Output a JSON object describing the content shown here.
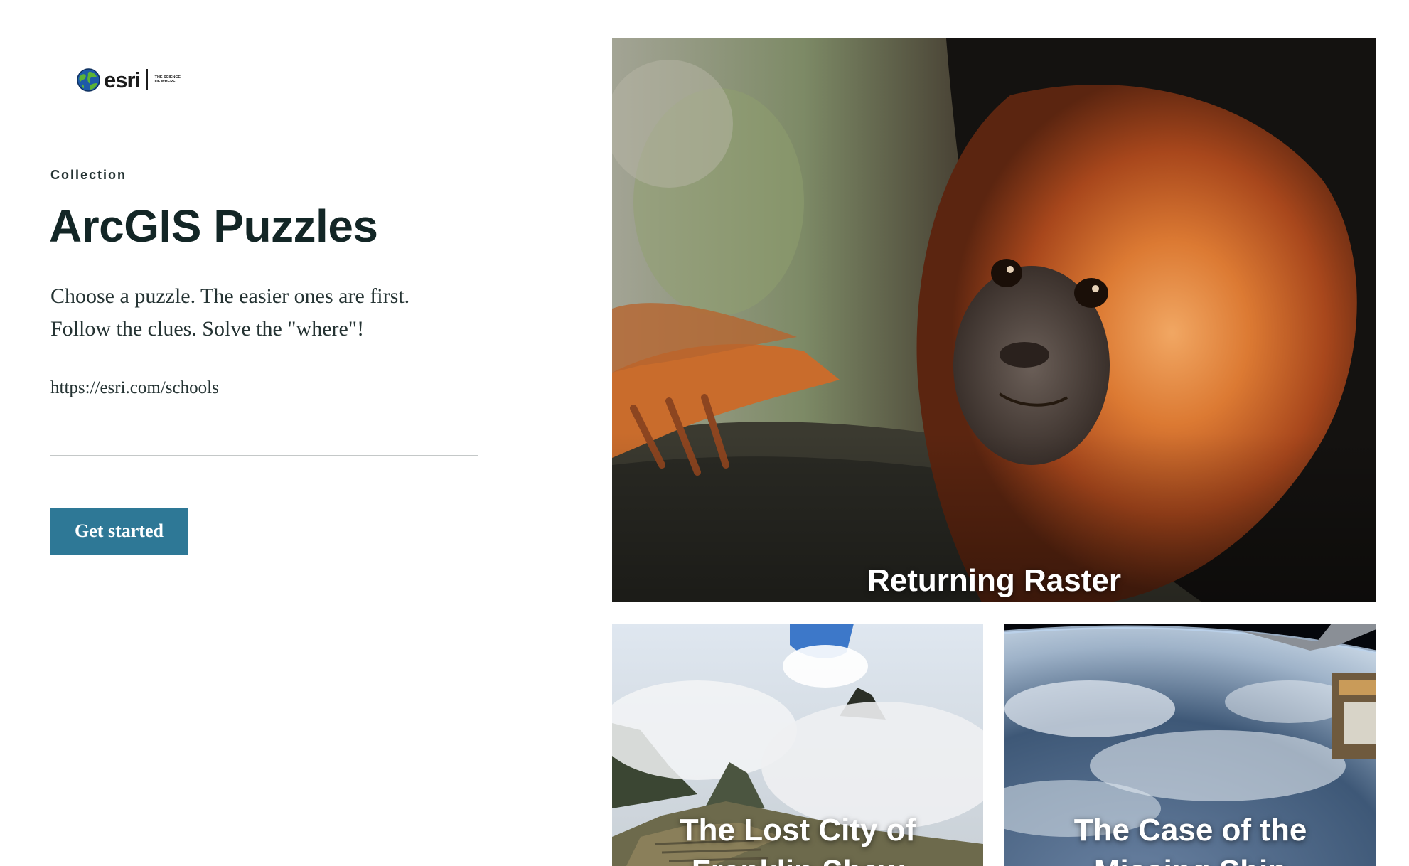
{
  "brand": {
    "wordmark": "esri",
    "tagline": "THE SCIENCE OF WHERE",
    "logo_icon": "globe-icon"
  },
  "intro": {
    "eyebrow": "Collection",
    "title": "ArcGIS Puzzles",
    "description_line1": "Choose a puzzle. The easier ones are first.",
    "description_line2": "Follow the clues. Solve the \"where\"!",
    "link": "https://esri.com/schools",
    "cta_label": "Get started"
  },
  "cards": [
    {
      "title": "Returning Raster",
      "image": "golden-lion-tamarin-photo"
    },
    {
      "title": "The Lost City of Franklin Shaw",
      "image": "machu-picchu-clouds-photo"
    },
    {
      "title": "The Case of the Missing Ship",
      "image": "earth-from-space-photo"
    }
  ],
  "colors": {
    "accent": "#2e7896",
    "heading": "#132626",
    "body_text": "#253333",
    "rule": "#c4c8c8"
  }
}
